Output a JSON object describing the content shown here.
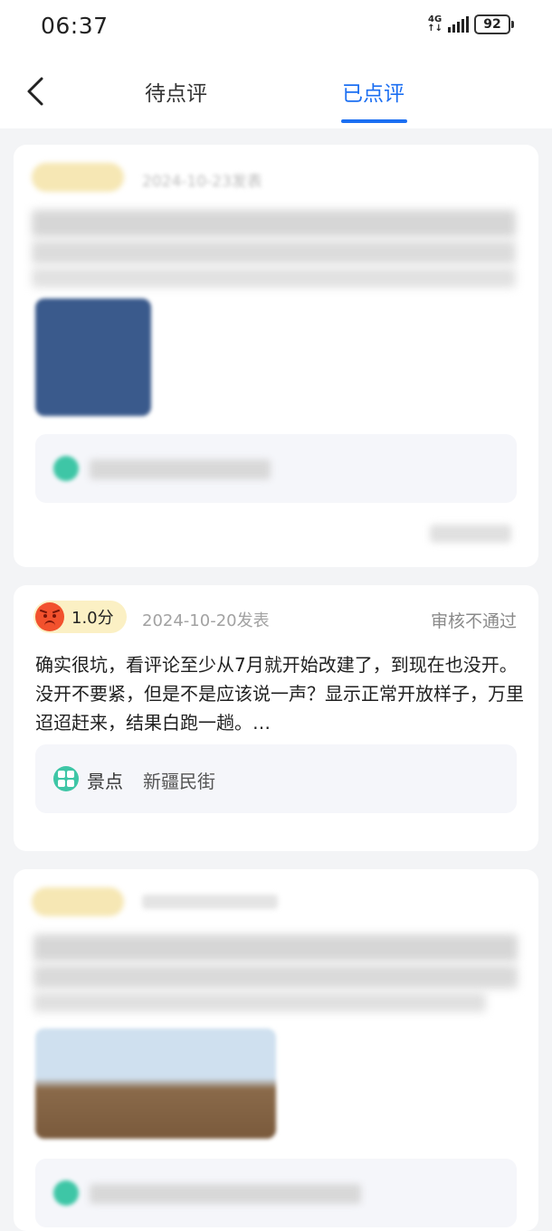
{
  "status_bar": {
    "time": "06:37",
    "network": "4G",
    "battery": "92"
  },
  "nav": {
    "tabs": [
      {
        "label": "待点评"
      },
      {
        "label": "已点评"
      }
    ],
    "active_tab": "已点评"
  },
  "reviews": [
    {
      "date": "2024-10-23发表",
      "note": "blurred review"
    },
    {
      "score": "1.0分",
      "date": "2024-10-20发表",
      "status": "审核不通过",
      "text": "确实很坑，看评论至少从7月就开始改建了，到现在也没开。没开不要紧，但是不是应该说一声？显示正常开放样子，万里迢迢赶来，结果白跑一趟。…",
      "place_type": "景点",
      "place_name": "新疆民街"
    },
    {
      "note": "blurred review"
    }
  ],
  "colors": {
    "accent": "#1c6ff2",
    "score_pill": "#fbf0c4",
    "place_icon": "#3ec6a6"
  },
  "icons": [
    "back-icon",
    "signal-icon",
    "battery-icon",
    "angry-face-icon",
    "attraction-icon"
  ]
}
